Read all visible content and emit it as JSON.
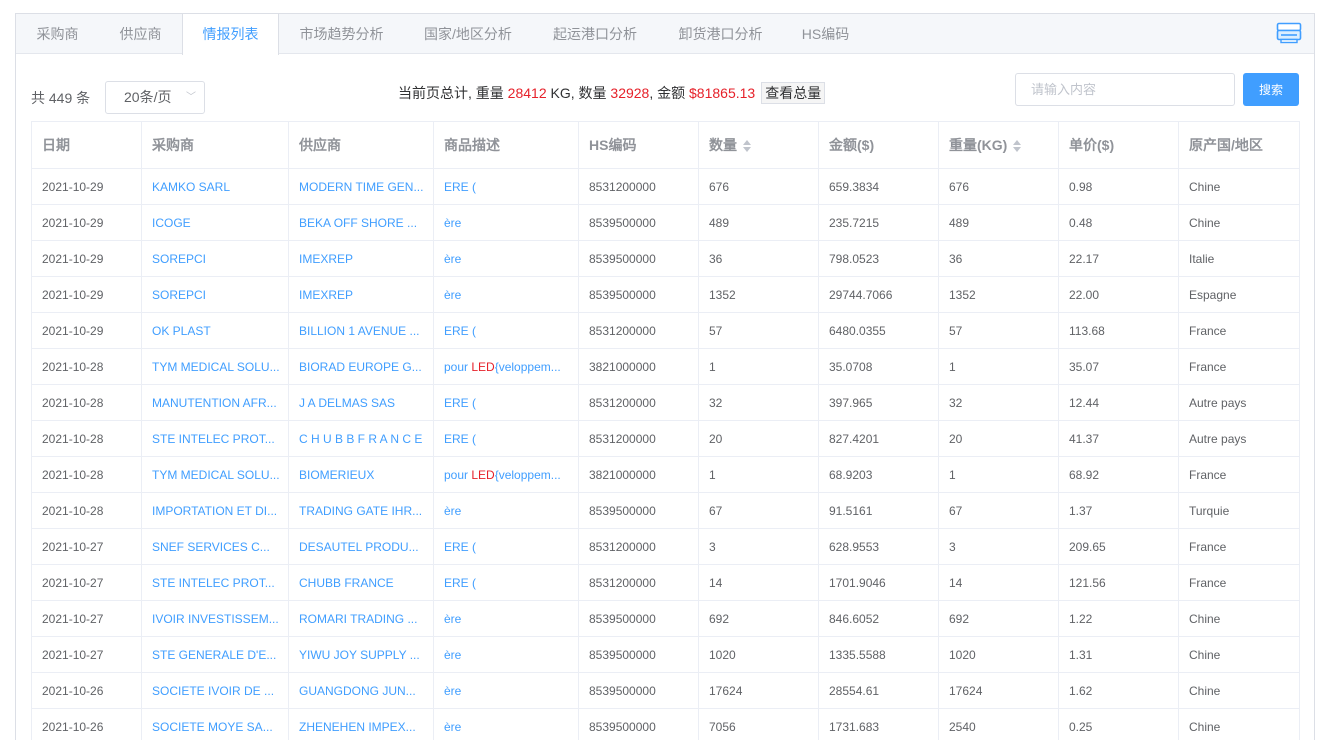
{
  "tabs": [
    {
      "label": "采购商",
      "active": false
    },
    {
      "label": "供应商",
      "active": false
    },
    {
      "label": "情报列表",
      "active": true
    },
    {
      "label": "市场趋势分析",
      "active": false
    },
    {
      "label": "国家/地区分析",
      "active": false
    },
    {
      "label": "起运港口分析",
      "active": false
    },
    {
      "label": "卸货港口分析",
      "active": false
    },
    {
      "label": "HS编码",
      "active": false
    }
  ],
  "print_icon": "printer-icon",
  "toolbar": {
    "total_text": "共 449 条",
    "page_size": "20条/页",
    "summary_prefix": "当前页总计, 重量 ",
    "weight": "28412",
    "weight_unit": " KG, 数量 ",
    "quantity": "32928",
    "amount_prefix": ", 金额 ",
    "amount": "$81865.13",
    "view_total_label": "查看总量",
    "search_placeholder": "请输入内容",
    "search_button": "搜索"
  },
  "colors": {
    "accent": "#409eff",
    "highlight": "#e6212a"
  },
  "table": {
    "columns": [
      "日期",
      "采购商",
      "供应商",
      "商品描述",
      "HS编码",
      "数量",
      "金额($)",
      "重量(KG)",
      "单价($)",
      "原产国/地区"
    ],
    "rows": [
      {
        "date": "2021-10-29",
        "buyer": "KAMKO SARL",
        "supplier": "MODERN TIME GEN...",
        "desc_pre": "ERE (",
        "desc_hl": "",
        "desc_post": "",
        "hs": "8531200000",
        "qty": "676",
        "amount": "659.3834",
        "weight": "676",
        "price": "0.98",
        "origin": "Chine"
      },
      {
        "date": "2021-10-29",
        "buyer": "ICOGE",
        "supplier": "BEKA OFF SHORE ...",
        "desc_pre": "ère",
        "desc_hl": "",
        "desc_post": "",
        "hs": "8539500000",
        "qty": "489",
        "amount": "235.7215",
        "weight": "489",
        "price": "0.48",
        "origin": "Chine"
      },
      {
        "date": "2021-10-29",
        "buyer": "SOREPCI",
        "supplier": "IMEXREP",
        "desc_pre": "ère",
        "desc_hl": "",
        "desc_post": "",
        "hs": "8539500000",
        "qty": "36",
        "amount": "798.0523",
        "weight": "36",
        "price": "22.17",
        "origin": "Italie"
      },
      {
        "date": "2021-10-29",
        "buyer": "SOREPCI",
        "supplier": "IMEXREP",
        "desc_pre": "ère",
        "desc_hl": "",
        "desc_post": "",
        "hs": "8539500000",
        "qty": "1352",
        "amount": "29744.7066",
        "weight": "1352",
        "price": "22.00",
        "origin": "Espagne"
      },
      {
        "date": "2021-10-29",
        "buyer": "OK PLAST",
        "supplier": "BILLION 1 AVENUE ...",
        "desc_pre": "ERE (",
        "desc_hl": "",
        "desc_post": "",
        "hs": "8531200000",
        "qty": "57",
        "amount": "6480.0355",
        "weight": "57",
        "price": "113.68",
        "origin": "France"
      },
      {
        "date": "2021-10-28",
        "buyer": "TYM MEDICAL SOLU...",
        "supplier": "BIORAD EUROPE G...",
        "desc_pre": "pour ",
        "desc_hl": "LED",
        "desc_post": "{veloppem...",
        "hs": "3821000000",
        "qty": "1",
        "amount": "35.0708",
        "weight": "1",
        "price": "35.07",
        "origin": "France"
      },
      {
        "date": "2021-10-28",
        "buyer": "MANUTENTION AFR...",
        "supplier": "J A DELMAS SAS",
        "desc_pre": "ERE (",
        "desc_hl": "",
        "desc_post": "",
        "hs": "8531200000",
        "qty": "32",
        "amount": "397.965",
        "weight": "32",
        "price": "12.44",
        "origin": "Autre pays"
      },
      {
        "date": "2021-10-28",
        "buyer": "STE INTELEC PROT...",
        "supplier": "C H U B B F R A N C E",
        "desc_pre": "ERE (",
        "desc_hl": "",
        "desc_post": "",
        "hs": "8531200000",
        "qty": "20",
        "amount": "827.4201",
        "weight": "20",
        "price": "41.37",
        "origin": "Autre pays"
      },
      {
        "date": "2021-10-28",
        "buyer": "TYM MEDICAL SOLU...",
        "supplier": "BIOMERIEUX",
        "desc_pre": "pour ",
        "desc_hl": "LED",
        "desc_post": "{veloppem...",
        "hs": "3821000000",
        "qty": "1",
        "amount": "68.9203",
        "weight": "1",
        "price": "68.92",
        "origin": "France"
      },
      {
        "date": "2021-10-28",
        "buyer": "IMPORTATION ET DI...",
        "supplier": "TRADING GATE IHR...",
        "desc_pre": "ère",
        "desc_hl": "",
        "desc_post": "",
        "hs": "8539500000",
        "qty": "67",
        "amount": "91.5161",
        "weight": "67",
        "price": "1.37",
        "origin": "Turquie"
      },
      {
        "date": "2021-10-27",
        "buyer": "SNEF SERVICES C...",
        "supplier": "DESAUTEL PRODU...",
        "desc_pre": "ERE (",
        "desc_hl": "",
        "desc_post": "",
        "hs": "8531200000",
        "qty": "3",
        "amount": "628.9553",
        "weight": "3",
        "price": "209.65",
        "origin": "France"
      },
      {
        "date": "2021-10-27",
        "buyer": "STE INTELEC PROT...",
        "supplier": "CHUBB FRANCE",
        "desc_pre": "ERE (",
        "desc_hl": "",
        "desc_post": "",
        "hs": "8531200000",
        "qty": "14",
        "amount": "1701.9046",
        "weight": "14",
        "price": "121.56",
        "origin": "France"
      },
      {
        "date": "2021-10-27",
        "buyer": "IVOIR INVESTISSEM...",
        "supplier": "ROMARI TRADING ...",
        "desc_pre": "ère",
        "desc_hl": "",
        "desc_post": "",
        "hs": "8539500000",
        "qty": "692",
        "amount": "846.6052",
        "weight": "692",
        "price": "1.22",
        "origin": "Chine"
      },
      {
        "date": "2021-10-27",
        "buyer": "STE GENERALE D'E...",
        "supplier": "YIWU JOY SUPPLY ...",
        "desc_pre": "ère",
        "desc_hl": "",
        "desc_post": "",
        "hs": "8539500000",
        "qty": "1020",
        "amount": "1335.5588",
        "weight": "1020",
        "price": "1.31",
        "origin": "Chine"
      },
      {
        "date": "2021-10-26",
        "buyer": "SOCIETE IVOIR DE ...",
        "supplier": "GUANGDONG JUN...",
        "desc_pre": "ère",
        "desc_hl": "",
        "desc_post": "",
        "hs": "8539500000",
        "qty": "17624",
        "amount": "28554.61",
        "weight": "17624",
        "price": "1.62",
        "origin": "Chine"
      },
      {
        "date": "2021-10-26",
        "buyer": "SOCIETE MOYE SA...",
        "supplier": "ZHENEHEN IMPEX...",
        "desc_pre": "ère",
        "desc_hl": "",
        "desc_post": "",
        "hs": "8539500000",
        "qty": "7056",
        "amount": "1731.683",
        "weight": "2540",
        "price": "0.25",
        "origin": "Chine"
      }
    ]
  }
}
